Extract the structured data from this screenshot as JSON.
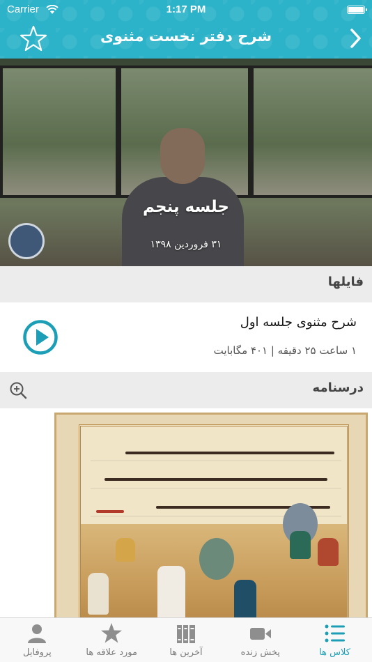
{
  "status_bar": {
    "carrier": "Carrier",
    "time": "1:17 PM"
  },
  "nav": {
    "title": "شرح دفتر نخست مثنوی",
    "accent_color": "#2cb3c9"
  },
  "video": {
    "title": "جلسه پنجم",
    "date": "۳۱ فروردین ۱۳۹۸"
  },
  "files": {
    "header": "فایلها",
    "items": [
      {
        "name": "شرح مثنوی جلسه اول",
        "meta": "۱ ساعت ۲۵ دقیقه | ۴۰۱ مگابایت",
        "icon": "play-circle-icon"
      }
    ]
  },
  "notes": {
    "header": "درسنامه",
    "zoom_icon": "zoom-in-icon"
  },
  "tabs": [
    {
      "label": "کلاس ها",
      "icon": "list-icon",
      "active": true
    },
    {
      "label": "پخش زنده",
      "icon": "video-camera-icon",
      "active": false
    },
    {
      "label": "آخرین ها",
      "icon": "books-icon",
      "active": false
    },
    {
      "label": "مورد علاقه ها",
      "icon": "star-icon",
      "active": false
    },
    {
      "label": "پروفایل",
      "icon": "person-icon",
      "active": false
    }
  ]
}
